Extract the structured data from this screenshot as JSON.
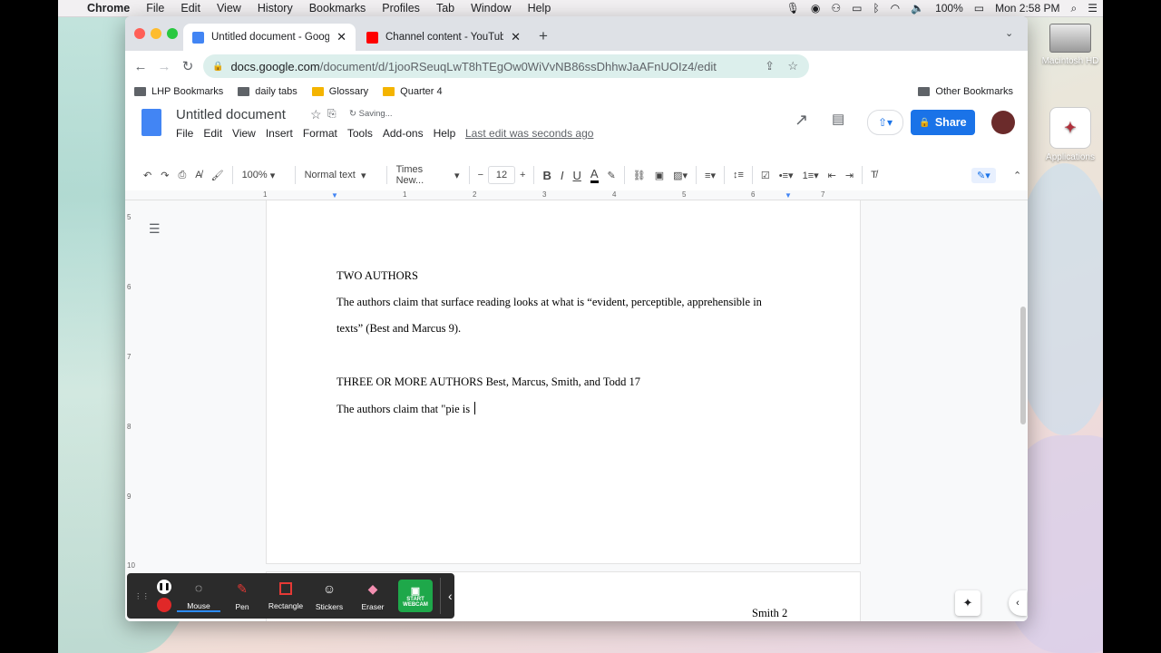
{
  "menubar": {
    "app": "Chrome",
    "items": [
      "File",
      "Edit",
      "View",
      "History",
      "Bookmarks",
      "Profiles",
      "Tab",
      "Window",
      "Help"
    ],
    "battery": "100%",
    "clock": "Mon 2:58 PM"
  },
  "desktop": {
    "icons": [
      "Macintosh HD",
      "Applications"
    ]
  },
  "browser": {
    "tabs": [
      {
        "title": "Untitled document - Google Do",
        "active": true
      },
      {
        "title": "Channel content - YouTube Stu",
        "active": false
      }
    ],
    "url_host": "docs.google.com",
    "url_path": "/document/d/1jooRSeuqLwT8hTEgOw0WiVvNB86ssDhhwJaAFnUOIz4/edit",
    "bookmarks": [
      "LHP Bookmarks",
      "daily tabs",
      "Glossary",
      "Quarter 4"
    ],
    "other_bookmarks": "Other Bookmarks"
  },
  "docs": {
    "title": "Untitled document",
    "status": "Saving...",
    "menu": [
      "File",
      "Edit",
      "View",
      "Insert",
      "Format",
      "Tools",
      "Add-ons",
      "Help"
    ],
    "last_edit": "Last edit was seconds ago",
    "share": "Share",
    "toolbar": {
      "zoom": "100%",
      "style": "Normal text",
      "font": "Times New...",
      "size": "12"
    },
    "ruler_h": [
      "1",
      "1",
      "2",
      "3",
      "4",
      "5",
      "6",
      "7"
    ],
    "ruler_v": [
      "5",
      "6",
      "7",
      "8",
      "9",
      "10"
    ],
    "lines": [
      "TWO AUTHORS",
      "The authors claim that surface reading looks at what is “evident, perceptible, apprehensible in",
      "texts” (Best and Marcus 9).",
      "THREE OR MORE AUTHORS Best, Marcus, Smith, and Todd 17",
      "The authors claim that \"pie is "
    ],
    "page2_header": "Smith 2"
  },
  "zoom_toolbar": {
    "items": [
      "Mouse",
      "Pen",
      "Rectangle",
      "Stickers",
      "Eraser"
    ],
    "webcam": "START WEBCAM"
  },
  "colors": {
    "share_blue": "#1a73e8",
    "omnibox": "#dcefec",
    "zoom_bg": "#2b2b2b",
    "webcam_green": "#1ea84a"
  }
}
